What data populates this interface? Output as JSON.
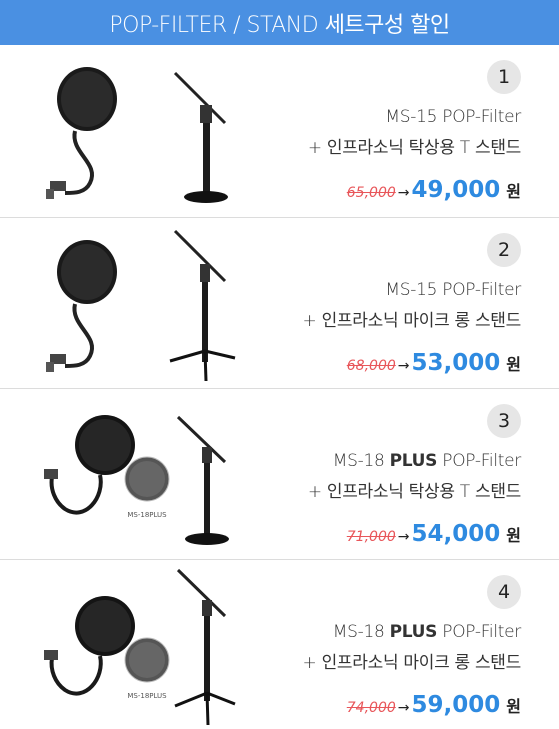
{
  "banner": {
    "title": "POP-FILTER / STAND 세트구성 할인"
  },
  "items": [
    {
      "number": "1",
      "model_prefix": "MS-15 ",
      "model_bold": "",
      "model_suffix": "POP-Filter",
      "stand": "+ 인프라소닉 탁상용 T 스탠드",
      "old_price": "65,000",
      "arrow": "→",
      "new_price": "49,000",
      "currency": "원",
      "product_label": ""
    },
    {
      "number": "2",
      "model_prefix": "MS-15 ",
      "model_bold": "",
      "model_suffix": "POP-Filter",
      "stand": "+ 인프라소닉 마이크 롱 스탠드",
      "old_price": "68,000",
      "arrow": "→",
      "new_price": "53,000",
      "currency": "원",
      "product_label": ""
    },
    {
      "number": "3",
      "model_prefix": "MS-18 ",
      "model_bold": "PLUS",
      "model_suffix": " POP-Filter",
      "stand": "+ 인프라소닉 탁상용 T 스탠드",
      "old_price": "71,000",
      "arrow": "→",
      "new_price": "54,000",
      "currency": "원",
      "product_label": "MS-18PLUS"
    },
    {
      "number": "4",
      "model_prefix": "MS-18 ",
      "model_bold": "PLUS",
      "model_suffix": " POP-Filter",
      "stand": "+ 인프라소닉 마이크 롱 스탠드",
      "old_price": "74,000",
      "arrow": "→",
      "new_price": "59,000",
      "currency": "원",
      "product_label": "MS-18PLUS"
    }
  ],
  "colors": {
    "banner": "#4a90e2",
    "new_price": "#2e8ae0",
    "old_price": "#e8565a"
  }
}
